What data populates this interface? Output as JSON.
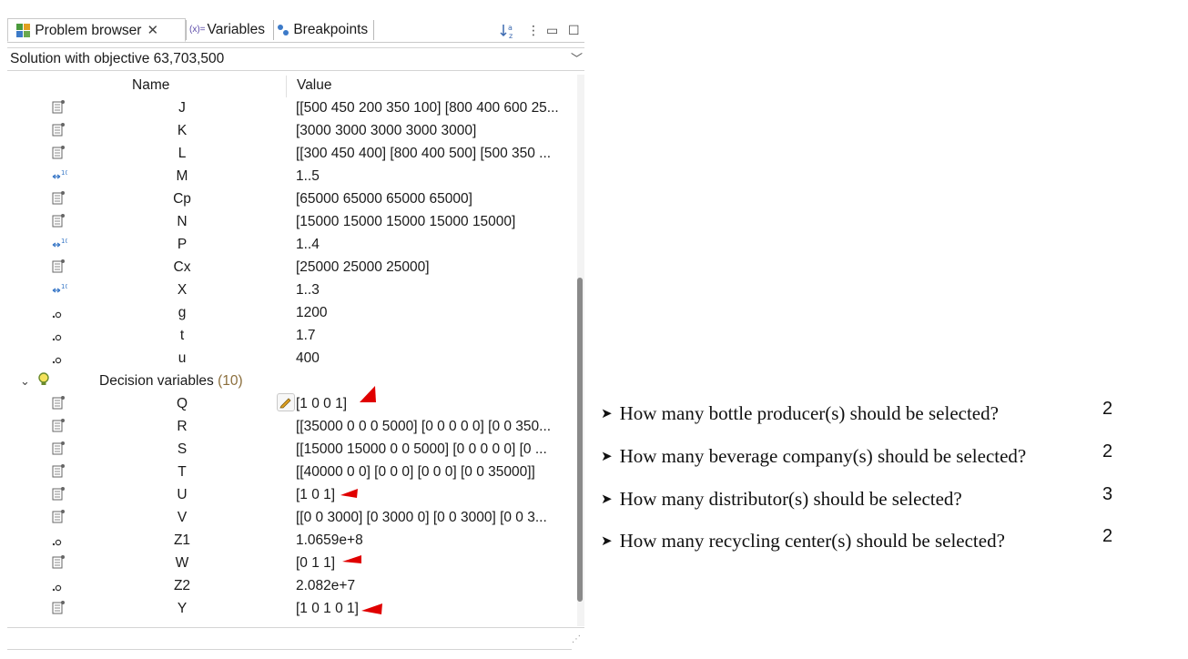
{
  "tabs": {
    "problem_browser": "Problem browser",
    "variables_prefix": "(x)=",
    "variables": "Variables",
    "breakpoints": "Breakpoints"
  },
  "solution_selector": "Solution with objective 63,703,500",
  "columns": {
    "name": "Name",
    "value": "Value"
  },
  "rows": [
    {
      "icon": "array-icon",
      "name": "J",
      "value": "[[500 450 200 350 100]  [800 400 600 25..."
    },
    {
      "icon": "array-icon",
      "name": "K",
      "value": "[3000 3000 3000 3000 3000]"
    },
    {
      "icon": "array-icon",
      "name": "L",
      "value": "[[300 450 400]  [800 400 500]  [500 350 ..."
    },
    {
      "icon": "range-icon",
      "name": "M",
      "value": "1..5"
    },
    {
      "icon": "array-icon",
      "name": "Cp",
      "value": "[65000 65000 65000 65000]"
    },
    {
      "icon": "array-icon",
      "name": "N",
      "value": "[15000 15000 15000 15000 15000]"
    },
    {
      "icon": "range-icon",
      "name": "P",
      "value": "1..4"
    },
    {
      "icon": "array-icon",
      "name": "Cx",
      "value": "[25000 25000 25000]"
    },
    {
      "icon": "range-icon",
      "name": "X",
      "value": "1..3"
    },
    {
      "icon": "scalar-icon",
      "name": "g",
      "value": "1200"
    },
    {
      "icon": "scalar-icon",
      "name": "t",
      "value": "1.7"
    },
    {
      "icon": "scalar-icon",
      "name": "u",
      "value": "400"
    }
  ],
  "decision_group": {
    "label": "Decision variables",
    "count": "(10)"
  },
  "decision_rows": [
    {
      "icon": "array-icon",
      "name": "Q",
      "value": "[1 0 0 1]"
    },
    {
      "icon": "array-icon",
      "name": "R",
      "value": "[[35000 0 0 0 5000]  [0 0 0 0 0]  [0 0 350..."
    },
    {
      "icon": "array-icon",
      "name": "S",
      "value": "[[15000 15000 0 0 5000]  [0 0 0 0 0]  [0 ..."
    },
    {
      "icon": "array-icon",
      "name": "T",
      "value": "[[40000 0 0]  [0 0 0]  [0 0 0]  [0 0 35000]]"
    },
    {
      "icon": "array-icon",
      "name": "U",
      "value": "[1 0 1]"
    },
    {
      "icon": "array-icon",
      "name": "V",
      "value": "[[0 0 3000]  [0 3000 0]  [0 0 3000]  [0 0 3..."
    },
    {
      "icon": "scalar-icon",
      "name": "Z1",
      "value": "1.0659e+8"
    },
    {
      "icon": "array-icon",
      "name": "W",
      "value": "[0 1 1]"
    },
    {
      "icon": "scalar-icon",
      "name": "Z2",
      "value": "2.082e+7"
    },
    {
      "icon": "array-icon",
      "name": "Y",
      "value": "[1 0 1 0 1]"
    }
  ],
  "questions": [
    {
      "text": "How many bottle producer(s) should be selected?",
      "answer": "2"
    },
    {
      "text": "How many beverage company(s) should be selected?",
      "answer": "2"
    },
    {
      "text": "How many distributor(s) should be selected?",
      "answer": "3"
    },
    {
      "text": "How many recycling center(s) should be selected?",
      "answer": "2"
    }
  ],
  "colors": {
    "accent_arrow": "#e00000",
    "group_count": "#8b6e3c"
  }
}
